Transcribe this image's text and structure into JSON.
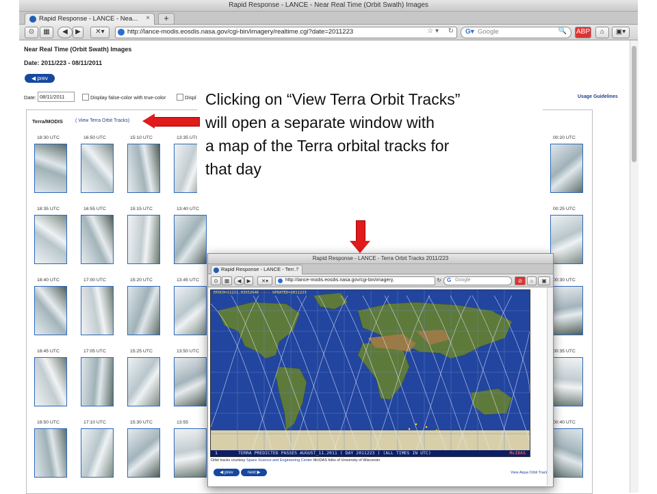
{
  "browser": {
    "window_title": "Rapid Response - LANCE - Near Real Time (Orbit Swath) Images",
    "tab_label": "Rapid Response - LANCE - Nea...",
    "tab_close": "×",
    "new_tab": "+",
    "url": "http://lance-modis.eosdis.nasa.gov/cgi-bin/imagery/realtime.cgi?date=2011223",
    "search_engine": "Google",
    "search_placeholder": "Google"
  },
  "page": {
    "title": "Near Real Time (Orbit Swath) Images",
    "date_line": "Date: 2011/223 - 08/11/2011",
    "prev_label": "◀ prev",
    "date_label": "Date:",
    "date_value": "08/11/2011",
    "option1": "Display false-color with true-color",
    "option2": "Displ",
    "usage_link": "Usage Guidelines",
    "sensor": "Terra/MODIS",
    "orbit_link": "( View Terra Orbit Tracks)"
  },
  "thumbnails": {
    "columns": [
      [
        "18:30 UTC",
        "18:35 UTC",
        "18:40 UTC",
        "18:45 UTC",
        "18:50 UTC"
      ],
      [
        "16:50 UTC",
        "16:55 UTC",
        "17:00 UTC",
        "17:05 UTC",
        "17:10 UTC"
      ],
      [
        "15:10 UTC",
        "15:15 UTC",
        "15:20 UTC",
        "15:25 UTC",
        "15:30 UTC"
      ],
      [
        "13:35 UTC",
        "13:40 UTC",
        "13:45 UTC",
        "13:50 UTC",
        "13:55"
      ],
      [
        "00:20 UTC",
        "00:25 UTC",
        "00:30 UTC",
        "00:35 UTC",
        "00:40 UTC"
      ]
    ]
  },
  "callout": {
    "line1": "Clicking on “View Terra Orbit Tracks”",
    "line2": "will open a separate window with",
    "line3": "a map of the Terra orbital tracks for",
    "line4": "that day"
  },
  "popup": {
    "window_title": "Rapid Response - LANCE - Terra Orbit Tracks 2011/223",
    "tab_label": "Rapid Response - LANCE - Terr...",
    "url": "http://lance-modis.eosdis.nasa.gov/cgi-bin/imagery,",
    "search_engine": "Google",
    "map_header": "EPOCH=11221.03552646 ---- UPDATED=2011223",
    "map_footer": "TERRA PREDICTED PASSES AUGUST_11.2011 ( DAY 2011223 ) (ALL TIMES IN UTC)",
    "map_footer_num": "1",
    "map_footer_brand": "McIDAS",
    "credit_prefix": "Orbit tracks courtesy",
    "credit_link": "Space Science and Engineering Center",
    "credit_suffix": "McIDAS folks of University of Wisconsin",
    "prev_label": "◀ prev",
    "next_label": "next ▶",
    "aqua_link": "View Aqua Orbit Tracks"
  }
}
